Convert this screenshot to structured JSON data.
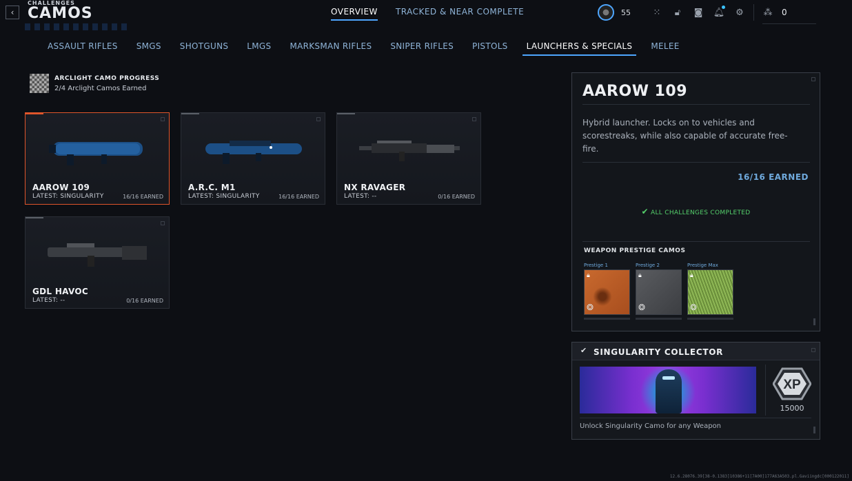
{
  "header": {
    "subtitle": "CHALLENGES",
    "title": "CAMOS",
    "back_glyph": "‹",
    "tabs": [
      {
        "label": "OVERVIEW",
        "active": true
      },
      {
        "label": "TRACKED & NEAR COMPLETE",
        "active": false
      }
    ],
    "level": "55",
    "currency": "0",
    "icons": [
      "grid-icon",
      "lock-icon",
      "camera-icon",
      "bell-icon",
      "gear-icon",
      "cod-points-icon"
    ]
  },
  "categories": [
    {
      "label": "ASSAULT RIFLES"
    },
    {
      "label": "SMGS"
    },
    {
      "label": "SHOTGUNS"
    },
    {
      "label": "LMGS"
    },
    {
      "label": "MARKSMAN RIFLES"
    },
    {
      "label": "SNIPER RIFLES"
    },
    {
      "label": "PISTOLS"
    },
    {
      "label": "LAUNCHERS & SPECIALS",
      "active": true
    },
    {
      "label": "MELEE"
    }
  ],
  "arclight": {
    "title": "ARCLIGHT CAMO PROGRESS",
    "subtitle": "2/4 Arclight Camos Earned"
  },
  "weapons": [
    {
      "name": "AAROW 109",
      "latest": "LATEST: SINGULARITY",
      "earned": "16/16 EARNED",
      "selected": true
    },
    {
      "name": "A.R.C. M1",
      "latest": "LATEST: SINGULARITY",
      "earned": "16/16 EARNED"
    },
    {
      "name": "NX RAVAGER",
      "latest": "LATEST: --",
      "earned": "0/16 EARNED"
    },
    {
      "name": "GDL HAVOC",
      "latest": "LATEST: --",
      "earned": "0/16 EARNED"
    }
  ],
  "detail": {
    "title": "AAROW 109",
    "description": "Hybrid launcher. Locks on to vehicles and scorestreaks, while also capable of accurate free-fire.",
    "earned": "16/16 EARNED",
    "complete_check": "✔",
    "complete": "ALL CHALLENGES COMPLETED",
    "prestige_title": "WEAPON PRESTIGE CAMOS",
    "prestige": [
      {
        "label": "Prestige 1",
        "color": "#c0622a"
      },
      {
        "label": "Prestige 2",
        "color": "#4a4c50"
      },
      {
        "label": "Prestige Max",
        "color": "#7fa84a"
      }
    ]
  },
  "challenge": {
    "check": "✔",
    "title": "SINGULARITY COLLECTOR",
    "xp_label": "XP",
    "xp_amount": "15000",
    "description": "Unlock Singularity Camo for any Weapon"
  },
  "build_info": "12.6.28076.39[38-0.1383]10386+11[7A00]177A63A503.pl.Gaviingdc[000122011]"
}
